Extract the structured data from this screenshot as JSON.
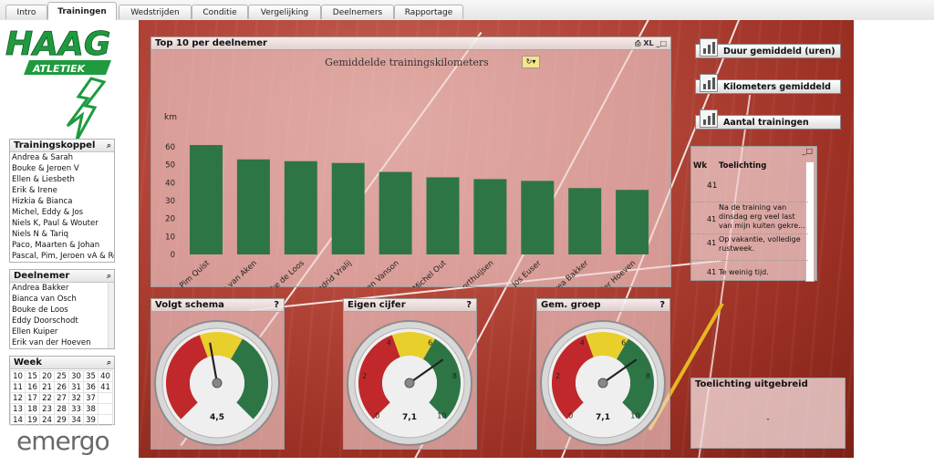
{
  "tabs": [
    "Intro",
    "Trainingen",
    "Wedstrijden",
    "Conditie",
    "Vergelijking",
    "Deelnemers",
    "Rapportage"
  ],
  "logo": {
    "text1": "HAAG",
    "text2": "ATLETIEK",
    "color": "#1f9a3f"
  },
  "brand": "emergo",
  "trainingskoppel": {
    "title": "Trainingskoppel",
    "items": [
      "Andrea & Sarah",
      "Bouke & Jeroen V",
      "Ellen & Liesbeth",
      "Erik & Irene",
      "Hizkia & Bianca",
      "Michel, Eddy & Jos",
      "Niels K, Paul & Wouter",
      "Niels N & Tariq",
      "Paco, Maarten & Johan",
      "Pascal, Pim, Jeroen vA & Remco"
    ]
  },
  "deelnemer": {
    "title": "Deelnemer",
    "items": [
      "Andrea Bakker",
      "Bianca van Osch",
      "Bouke de Loos",
      "Eddy Doorschodt",
      "Ellen Kuiper",
      "Erik van der Hoeven"
    ]
  },
  "week": {
    "title": "Week",
    "rows": [
      [
        "10",
        "15",
        "20",
        "25",
        "30",
        "35",
        "40"
      ],
      [
        "11",
        "16",
        "21",
        "26",
        "31",
        "36",
        "41"
      ],
      [
        "12",
        "17",
        "22",
        "27",
        "32",
        "37",
        ""
      ],
      [
        "13",
        "18",
        "23",
        "28",
        "33",
        "38",
        ""
      ],
      [
        "14",
        "19",
        "24",
        "29",
        "34",
        "39",
        ""
      ]
    ]
  },
  "top10": {
    "title": "Top 10 per deelnemer",
    "controls": "XL"
  },
  "chart_data": {
    "type": "bar",
    "title": "Gemiddelde trainingskilometers",
    "ylabel": "km",
    "ylim": [
      0,
      60
    ],
    "yticks": [
      "0",
      "10",
      "20",
      "30",
      "40",
      "50",
      "60"
    ],
    "categories": [
      "Pim Quist",
      "Jeroen van Aken",
      "Bouke de Loos",
      "Paco Lamadrid Vralij",
      "Jeroen Vanson",
      "Michel Out",
      "Liesbeth Voorthuijsen",
      "Jos Euser",
      "Andrea Bakker",
      "Erik van der Hoeven"
    ],
    "values": [
      61,
      53,
      52,
      51,
      46,
      43,
      42,
      41,
      37,
      36
    ],
    "bar_color": "#2e7545"
  },
  "buttons": [
    "Duur gemiddeld (uren)",
    "Kilometers gemiddeld",
    "Aantal trainingen"
  ],
  "toelichting": {
    "col_wk": "Wk",
    "col_text": "Toelichting",
    "rows": [
      {
        "wk": "41",
        "text": ""
      },
      {
        "wk": "41",
        "text": "Na de training van dinsdag erg veel last van mijn kuiten gekre..."
      },
      {
        "wk": "41",
        "text": "Op vakantie, volledige rustweek."
      },
      {
        "wk": "41",
        "text": "Te weinig tijd."
      }
    ]
  },
  "gauges": [
    {
      "title": "Volgt schema",
      "value": "4,5",
      "labels": [],
      "needle_deg": -10
    },
    {
      "title": "Eigen cijfer",
      "value": "7,1",
      "labels": [
        "0",
        "2",
        "4",
        "6",
        "8",
        "10"
      ],
      "needle_deg": 55
    },
    {
      "title": "Gem. groep",
      "value": "7,1",
      "labels": [
        "0",
        "2",
        "4",
        "6",
        "8",
        "10"
      ],
      "needle_deg": 55
    }
  ],
  "toelichting_uitgebreid": {
    "title": "Toelichting uitgebreid",
    "value": "-"
  },
  "colors": {
    "green": "#2e7545",
    "red": "#c0282c",
    "yellow": "#e8cf2c"
  }
}
